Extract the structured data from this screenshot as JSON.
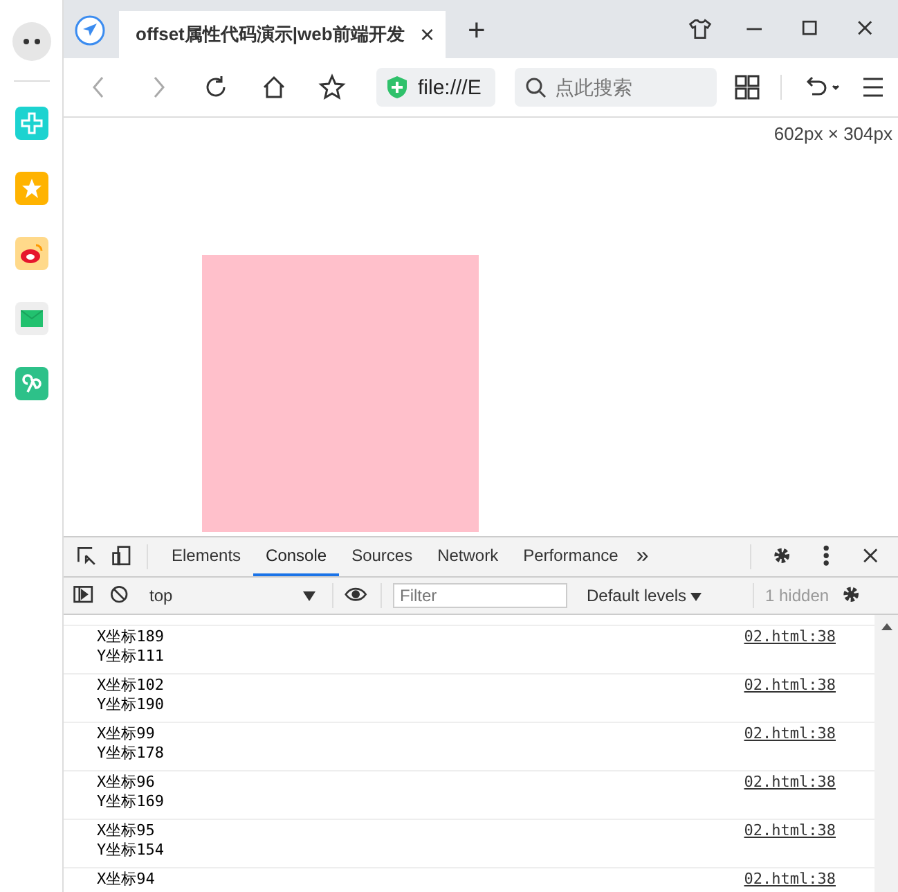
{
  "tab": {
    "title": "offset属性代码演示|web前端开发",
    "close": "×",
    "new_tab": "+"
  },
  "toolbar": {
    "address": "file:///E",
    "search_placeholder": "点此搜索"
  },
  "viewport": {
    "size_label": "602px × 304px"
  },
  "devtools": {
    "tabs": [
      {
        "label": "Elements",
        "selected": false
      },
      {
        "label": "Console",
        "selected": true
      },
      {
        "label": "Sources",
        "selected": false
      },
      {
        "label": "Network",
        "selected": false
      },
      {
        "label": "Performance",
        "selected": false
      }
    ],
    "more": "»",
    "context": "top",
    "filter_placeholder": "Filter",
    "levels": "Default levels",
    "hidden_count": "1 hidden",
    "messages": [
      {
        "lines": [
          "X坐标189",
          "Y坐标111"
        ],
        "source": "02.html:38"
      },
      {
        "lines": [
          "X坐标102",
          "Y坐标190"
        ],
        "source": "02.html:38"
      },
      {
        "lines": [
          "X坐标99",
          "Y坐标178"
        ],
        "source": "02.html:38"
      },
      {
        "lines": [
          "X坐标96",
          "Y坐标169"
        ],
        "source": "02.html:38"
      },
      {
        "lines": [
          "X坐标95",
          "Y坐标154"
        ],
        "source": "02.html:38"
      },
      {
        "lines": [
          "X坐标94"
        ],
        "source": "02.html:38"
      }
    ]
  }
}
